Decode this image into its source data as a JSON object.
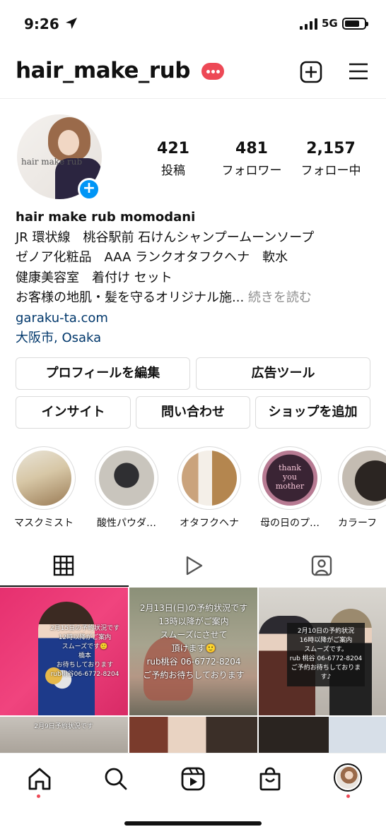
{
  "status_bar": {
    "time": "9:26",
    "network": "5G"
  },
  "header": {
    "username": "hair_make_rub"
  },
  "profile": {
    "avatar_watermark": "hair make rub",
    "stats": [
      {
        "value": "421",
        "label": "投稿"
      },
      {
        "value": "481",
        "label": "フォロワー"
      },
      {
        "value": "2,157",
        "label": "フォロー中"
      }
    ],
    "name": "hair make rub momodani",
    "bio_lines": [
      "JR 環状線　桃谷駅前 石けんシャンプームーンソープ",
      "ゼノア化粧品　AAA ランクオタフクヘナ　軟水",
      "健康美容室　着付け セット",
      "お客様の地肌・髪を守るオリジナル施..."
    ],
    "more_label": "続きを読む",
    "website": "garaku-ta.com",
    "location": "大阪市, Osaka"
  },
  "buttons": {
    "edit_profile": "プロフィールを編集",
    "ad_tools": "広告ツール",
    "insights": "インサイト",
    "contact": "問い合わせ",
    "add_shop": "ショップを追加"
  },
  "highlights": [
    {
      "label": "マスクミスト"
    },
    {
      "label": "酸性パウダ…"
    },
    {
      "label": "オタフクヘナ"
    },
    {
      "label": "母の日のプ…"
    },
    {
      "label": "カラーフ"
    }
  ],
  "highlight_texts": {
    "h4_line1": "thank",
    "h4_line2": "you",
    "h4_line3": "mother"
  },
  "grid_posts": [
    {
      "text": "2月15日の予約状況です\n12時以降がご案内\nスムーズです🙂\n橋本\nお待ちしております\nrub桃谷06-6772-8204"
    },
    {
      "text": "2月13日(日)の予約状況です\n13時以降がご案内\nスムーズにさせて\n頂けます🙂\nrub桃谷 06-6772-8204\nご予約お待ちしております"
    },
    {
      "text": "2月10日の予約状況\n16時以降がご案内\nスムーズです。\nrub 桃谷 06-6772-8204\nご予約お待ちしております♪"
    },
    {
      "text": "2月9日予約状況です"
    }
  ],
  "colors": {
    "accent": "#0095f6",
    "notification": "#ed4956",
    "link": "#00376b",
    "muted": "#8e8e8e",
    "border": "#dbdbdb"
  },
  "icons": {
    "status": [
      "location-arrow-icon",
      "signal-icon",
      "battery-icon"
    ],
    "header": [
      "new-post-icon",
      "menu-icon"
    ],
    "tabs": [
      "grid-icon",
      "reels-icon",
      "tagged-icon"
    ],
    "bottom_nav": [
      "home-icon",
      "search-icon",
      "reels-icon",
      "shop-icon",
      "profile-avatar"
    ]
  }
}
